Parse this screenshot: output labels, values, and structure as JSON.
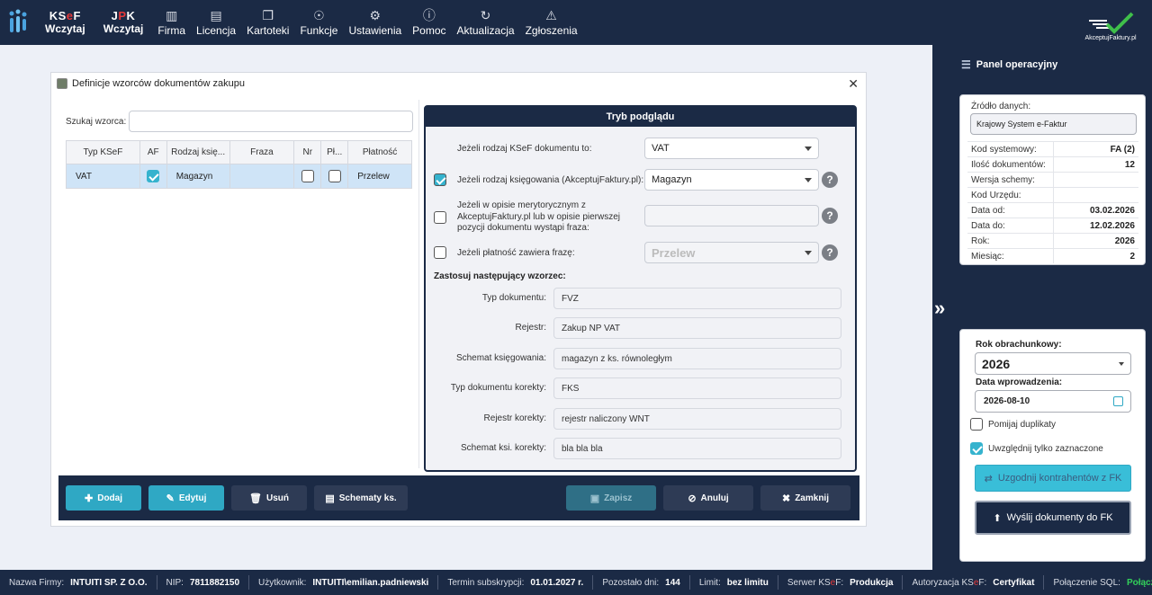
{
  "nav": {
    "ksef": {
      "top_a": "KS",
      "top_b": "e",
      "top_c": "F",
      "bottom": "Wczytaj"
    },
    "jpk": {
      "top_a": "J",
      "top_b": "P",
      "top_c": "K",
      "bottom": "Wczytaj"
    },
    "items": [
      {
        "label": "Firma",
        "icon": "building-icon"
      },
      {
        "label": "Licencja",
        "icon": "license-icon"
      },
      {
        "label": "Kartoteki",
        "icon": "folders-icon"
      },
      {
        "label": "Funkcje",
        "icon": "hand-coin-icon"
      },
      {
        "label": "Ustawienia",
        "icon": "gear-icon"
      },
      {
        "label": "Pomoc",
        "icon": "help-icon"
      },
      {
        "label": "Aktualizacja",
        "icon": "refresh-icon"
      },
      {
        "label": "Zgłoszenia",
        "icon": "warning-icon"
      }
    ],
    "brand": "AkceptujFaktury.pl"
  },
  "dialog": {
    "title": "Definicje wzorców dokumentów zakupu",
    "search_label": "Szukaj wzorca:",
    "search_value": "",
    "grid": {
      "headers": [
        "Typ KSeF",
        "AF",
        "Rodzaj księ...",
        "Fraza",
        "Nr",
        "Pł...",
        "Płatność"
      ],
      "rows": [
        {
          "typ": "VAT",
          "af": true,
          "rodzaj": "Magazyn",
          "fraza": "",
          "nr": false,
          "pl": false,
          "platnosc": "Przelew"
        }
      ]
    },
    "preview": {
      "header": "Tryb podglądu",
      "cond1_label": "Jeżeli rodzaj KSeF dokumentu to:",
      "cond1_value": "VAT",
      "cond2_label": "Jeżeli rodzaj księgowania (AkceptujFaktury.pl):",
      "cond2_value": "Magazyn",
      "cond2_checked": true,
      "cond3_label_1": "Jeżeli w opisie merytorycznym z",
      "cond3_label_2": "AkceptujFaktury.pl lub w opisie pierwszej",
      "cond3_label_3": "pozycji dokumentu wystąpi fraza:",
      "cond3_value": "",
      "cond4_label": "Jeżeli płatność zawiera frazę:",
      "cond4_value": "Przelew",
      "apply_label": "Zastosuj następujący wzorzec:",
      "fields": [
        {
          "label": "Typ dokumentu:",
          "value": "FVZ"
        },
        {
          "label": "Rejestr:",
          "value": "Zakup NP VAT"
        },
        {
          "label": "Schemat księgowania:",
          "value": "magazyn z ks. równoległym"
        },
        {
          "label": "Typ dokumentu korekty:",
          "value": "FKS"
        },
        {
          "label": "Rejestr korekty:",
          "value": "rejestr naliczony WNT"
        },
        {
          "label": "Schemat ksi. korekty:",
          "value": "bla bla bla"
        }
      ]
    },
    "toolbar": {
      "add": "Dodaj",
      "edit": "Edytuj",
      "delete": "Usuń",
      "schemas": "Schematy ks.",
      "save": "Zapisz",
      "cancel": "Anuluj",
      "close": "Zamknij"
    }
  },
  "panel": {
    "title": "Panel operacyjny",
    "source_label": "Źródło danych:",
    "source_value": "Krajowy System e-Faktur",
    "info": [
      {
        "k": "Kod systemowy:",
        "v": "FA (2)"
      },
      {
        "k": "Ilość dokumentów:",
        "v": "12"
      },
      {
        "k": "Wersja schemy:",
        "v": ""
      },
      {
        "k": "Kod Urzędu:",
        "v": ""
      },
      {
        "k": "Data od:",
        "v": "03.02.2026"
      },
      {
        "k": "Data do:",
        "v": "12.02.2026"
      },
      {
        "k": "Rok:",
        "v": "2026"
      },
      {
        "k": "Miesiąc:",
        "v": "2"
      }
    ],
    "year_label": "Rok obrachunkowy:",
    "year_value": "2026",
    "date_label": "Data wprowadzenia:",
    "date_value": "2026-08-10",
    "skip_duplicates": "Pomijaj duplikaty",
    "only_selected": "Uwzględnij tylko zaznaczone",
    "match_btn": "Uzgodnij kontrahentów z FK",
    "send_btn": "Wyślij dokumenty do FK"
  },
  "status": [
    {
      "k": "Nazwa Firmy:",
      "v": "INTUITI SP. Z O.O."
    },
    {
      "k": "NIP:",
      "v": "7811882150"
    },
    {
      "k": "Użytkownik:",
      "v": "INTUITI\\emilian.padniewski"
    },
    {
      "k": "Termin subskrypcji:",
      "v": "01.01.2027 r."
    },
    {
      "k": "Pozostało dni:",
      "v": "144"
    },
    {
      "k": "Limit:",
      "v": "bez limitu"
    },
    {
      "k_a": "Serwer KS",
      "k_b": "e",
      "k_c": "F:",
      "v": "Produkcja"
    },
    {
      "k_a": "Autoryzacja KS",
      "k_b": "e",
      "k_c": "F:",
      "v": "Certyfikat"
    },
    {
      "k": "Połączenie SQL:",
      "v": "Połączono"
    }
  ]
}
